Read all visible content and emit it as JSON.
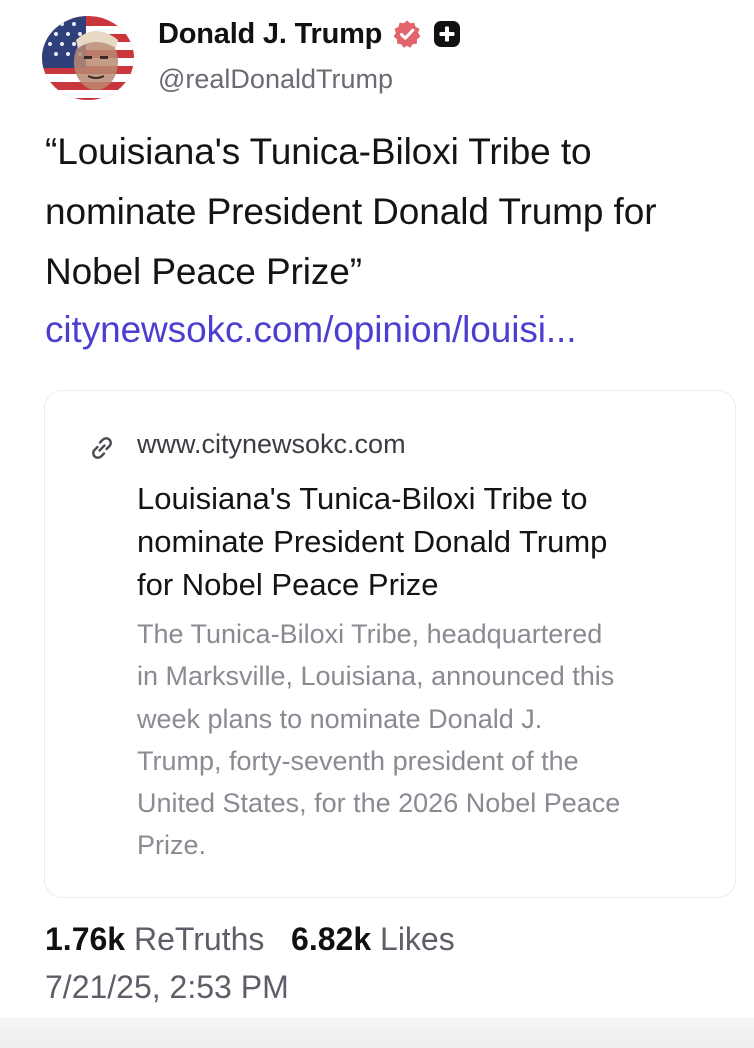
{
  "author": {
    "display_name": "Donald J. Trump",
    "handle": "@realDonaldTrump",
    "verified_badge_icon": "verified-check-icon",
    "plus_badge_icon": "plus-badge-icon",
    "verified_color": "#e3646c"
  },
  "post": {
    "text_line1": "“Louisiana's Tunica-Biloxi Tribe to",
    "text_line2": "nominate President Donald Trump for",
    "text_line3": "Nobel Peace Prize”",
    "link_text": "citynewsokc.com/opinion/louisi...",
    "link_color": "#4b3fd1"
  },
  "link_card": {
    "icon": "link-icon",
    "domain": "www.citynewsokc.com",
    "title_line1": "Louisiana's Tunica-Biloxi Tribe to",
    "title_line2": "nominate President Donald Trump",
    "title_line3": "for Nobel Peace Prize",
    "desc_line1": "The Tunica-Biloxi Tribe, headquartered",
    "desc_line2": "in Marksville, Louisiana, announced this",
    "desc_line3": "week plans to nominate Donald J.",
    "desc_line4": "Trump, forty-seventh president of the",
    "desc_line5": "United States, for the 2026 Nobel Peace",
    "desc_line6": "Prize."
  },
  "stats": {
    "retruths_count": "1.76k",
    "retruths_label": "ReTruths",
    "likes_count": "6.82k",
    "likes_label": "Likes"
  },
  "timestamp": "7/21/25, 2:53 PM"
}
